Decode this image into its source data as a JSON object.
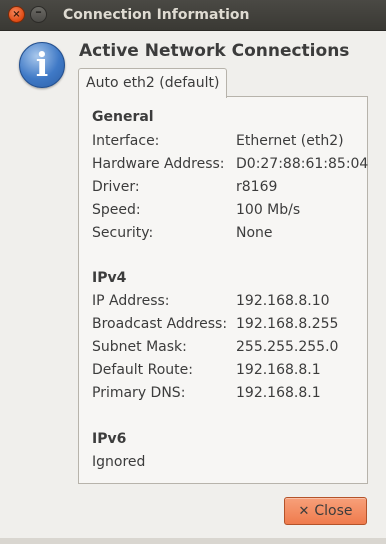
{
  "window": {
    "title": "Connection Information",
    "close_glyph": "×",
    "minimize_glyph": "–"
  },
  "dialog": {
    "icon": "info-icon",
    "icon_glyph": "i",
    "heading": "Active Network Connections",
    "tab_label": "Auto eth2 (default)",
    "sections": {
      "general": {
        "title": "General",
        "rows": [
          {
            "label": "Interface:",
            "value": "Ethernet (eth2)"
          },
          {
            "label": "Hardware Address:",
            "value": "D0:27:88:61:85:04"
          },
          {
            "label": "Driver:",
            "value": "r8169"
          },
          {
            "label": "Speed:",
            "value": "100 Mb/s"
          },
          {
            "label": "Security:",
            "value": "None"
          }
        ]
      },
      "ipv4": {
        "title": "IPv4",
        "rows": [
          {
            "label": "IP Address:",
            "value": "192.168.8.10"
          },
          {
            "label": "Broadcast Address:",
            "value": "192.168.8.255"
          },
          {
            "label": "Subnet Mask:",
            "value": "255.255.255.0"
          },
          {
            "label": "Default Route:",
            "value": "192.168.8.1"
          },
          {
            "label": "Primary DNS:",
            "value": "192.168.8.1"
          }
        ]
      },
      "ipv6": {
        "title": "IPv6",
        "status": "Ignored"
      }
    },
    "close_button_label": "Close",
    "close_button_glyph": "✕"
  },
  "colors": {
    "accent_close": "#ef7b4d",
    "titlebar": "#3f3e39",
    "info_blue": "#3f79c6"
  }
}
